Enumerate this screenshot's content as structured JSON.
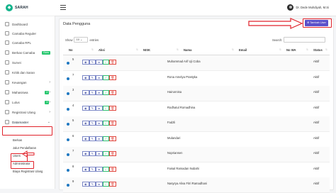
{
  "app": {
    "brand": "SARAH"
  },
  "header": {
    "user_name": "Dr. Dede Muhdiyah, M.Si"
  },
  "sidebar": {
    "items": [
      {
        "label": "Dashboard",
        "chevron": ""
      },
      {
        "label": "Camaba Reguler",
        "chevron": ""
      },
      {
        "label": "Camaba RPL",
        "chevron": ""
      },
      {
        "label": "Berkas Camaba",
        "chevron": "",
        "badge": "Baru"
      },
      {
        "label": "Survei",
        "chevron": ""
      },
      {
        "label": "Kritik dan Saran",
        "chevron": ""
      },
      {
        "label": "Keuangan",
        "chevron": "›"
      },
      {
        "label": "Mahasiswa",
        "chevron": "›",
        "badge": "2"
      },
      {
        "label": "Lulus",
        "chevron": "›",
        "badge": "3"
      },
      {
        "label": "Registrasi Ulang",
        "chevron": "›"
      },
      {
        "label": "Datamaster",
        "chevron": "⌄"
      }
    ],
    "sub_items": [
      "Berkas",
      "Jalur Pendaftaran",
      "Users",
      "Administrator",
      "Biaya Registrasi Ulang"
    ]
  },
  "page": {
    "title": "Data Pengguna",
    "add_button": "Tambah User",
    "show_label": "Show",
    "show_value": "10",
    "entries_label": "entries",
    "search_label": "Search:"
  },
  "table": {
    "headers": [
      "No",
      "Aksi",
      "NISK",
      "Nama",
      "Email",
      "No WA",
      "Status"
    ],
    "rows": [
      {
        "no": "5",
        "name": "Muhammad Arif Uji Coba",
        "status": "Aktif"
      },
      {
        "no": "7",
        "name": "Rona Amelya Prastyka",
        "status": "Aktif"
      },
      {
        "no": "3",
        "name": "Hairunnisa",
        "status": "Aktif"
      },
      {
        "no": "4",
        "name": "Rodhatul Romadhina",
        "status": "Aktif"
      },
      {
        "no": "5",
        "name": "Fadzli",
        "status": "Aktif"
      },
      {
        "no": "6",
        "name": "Mulandari",
        "status": "Aktif"
      },
      {
        "no": "7",
        "name": "Nopriansen",
        "status": "Aktif"
      },
      {
        "no": "8",
        "name": "Faisal Ramadan Nubahi",
        "status": "Aktif"
      },
      {
        "no": "9",
        "name": "Nasyrya Aliva Fitri Ramadhani",
        "status": "Aktif"
      }
    ],
    "action_icons": [
      "view-icon",
      "edit-icon",
      "user-icon",
      "check-icon",
      "delete-icon"
    ]
  },
  "colors": {
    "accent": "#5b4fc9",
    "highlight": "#e0222a",
    "brand": "#13b38b"
  }
}
